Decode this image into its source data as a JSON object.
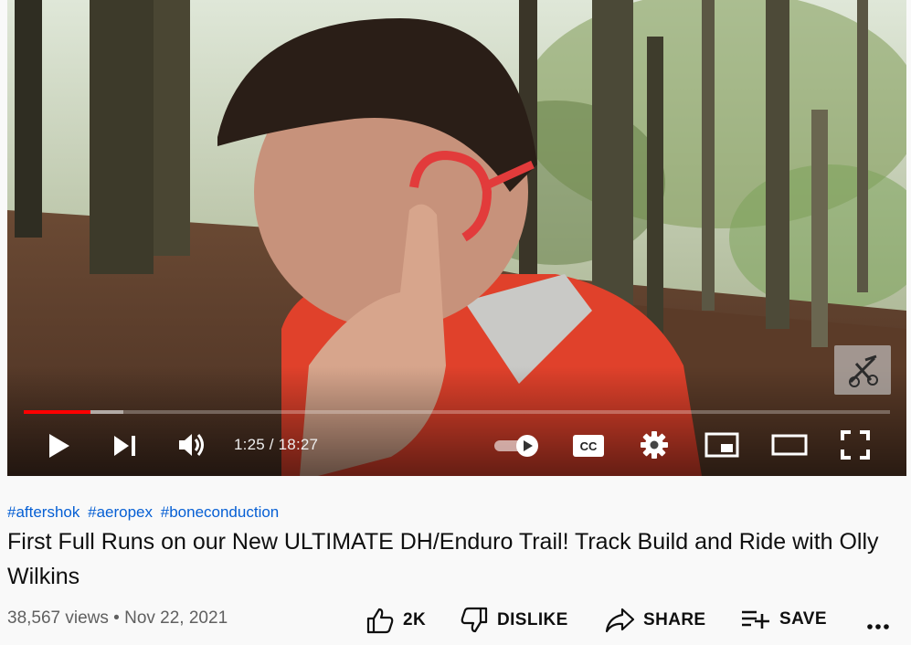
{
  "video": {
    "progress_played": 0.077,
    "progress_loaded": 0.115,
    "time_display": "1:25 / 18:27"
  },
  "controls": {
    "play": "play-icon",
    "next": "next-icon",
    "volume": "volume-icon",
    "autoplay": "autoplay-toggle",
    "captions": "CC",
    "settings": "gear-icon",
    "miniplayer": "miniplayer-icon",
    "theater": "theater-icon",
    "fullscreen": "fullscreen-icon"
  },
  "meta": {
    "hashtags": [
      "#aftershok",
      "#aeropex",
      "#boneconduction"
    ],
    "title": "First Full Runs on our New ULTIMATE DH/Enduro Trail! Track Build and Ride with Olly Wilkins",
    "views_date": "38,567 views • Nov 22, 2021"
  },
  "actions": {
    "like_count": "2K",
    "dislike_label": "DISLIKE",
    "share_label": "SHARE",
    "save_label": "SAVE",
    "more": "more-icon"
  },
  "colors": {
    "progress": "#ff0000",
    "link": "#065fd4",
    "text": "#0f0f0f",
    "secondary": "#606060"
  }
}
